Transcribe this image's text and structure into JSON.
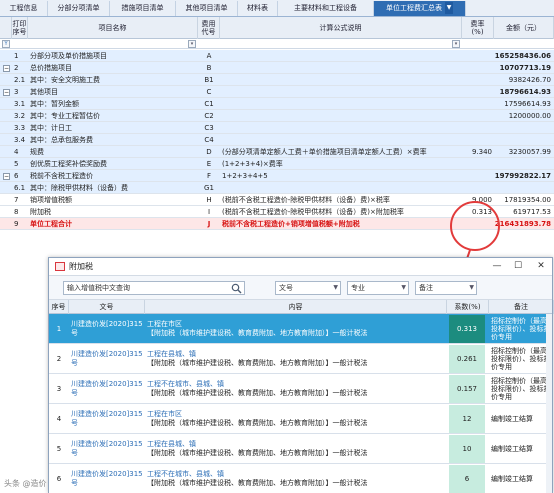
{
  "tabs": [
    "工程信息",
    "分部分项清单",
    "措施项目清单",
    "其他项目清单",
    "材料表",
    "主要材料和工程设备",
    "单位工程费汇总表"
  ],
  "active_tab_index": 6,
  "grid": {
    "headers": {
      "print": "打印\n序号",
      "name": "项目名称",
      "code": "费用\n代号",
      "formula": "计算公式说明",
      "rate": "费率\n(%)",
      "amount": "金额（元）"
    },
    "rows": [
      {
        "num": "1",
        "name": "分部分项及单价措施项目",
        "code": "A",
        "formula": "",
        "rate": "",
        "amount": "165258436.06",
        "style": "blue",
        "bold": true
      },
      {
        "num": "2",
        "name": "总价措施项目",
        "code": "B",
        "formula": "",
        "rate": "",
        "amount": "10707713.19",
        "style": "blue",
        "bold": true,
        "collapse": true
      },
      {
        "num": "2.1",
        "name": "  其中：安全文明施工费",
        "code": "B1",
        "formula": "",
        "rate": "",
        "amount": "9382426.70",
        "style": "blue"
      },
      {
        "num": "3",
        "name": "其他项目",
        "code": "C",
        "formula": "",
        "rate": "",
        "amount": "18796614.93",
        "style": "blue",
        "bold": true,
        "collapse": true
      },
      {
        "num": "3.1",
        "name": "  其中：暂列金额",
        "code": "C1",
        "formula": "",
        "rate": "",
        "amount": "17596614.93",
        "style": "blue"
      },
      {
        "num": "3.2",
        "name": "  其中：专业工程暂估价",
        "code": "C2",
        "formula": "",
        "rate": "",
        "amount": "1200000.00",
        "style": "blue"
      },
      {
        "num": "3.3",
        "name": "  其中：计日工",
        "code": "C3",
        "formula": "",
        "rate": "",
        "amount": "",
        "style": "blue"
      },
      {
        "num": "3.4",
        "name": "  其中：总承包服务费",
        "code": "C4",
        "formula": "",
        "rate": "",
        "amount": "",
        "style": "blue"
      },
      {
        "num": "4",
        "name": "规费",
        "code": "D",
        "formula": "(分部分项清单定额人工费＋单价措施项目清单定额人工费）×费率",
        "rate": "9.340",
        "amount": "3230057.99",
        "style": "blue"
      },
      {
        "num": "5",
        "name": "创优质工程奖补偿奖励费",
        "code": "E",
        "formula": "(1+2+3+4)×费率",
        "rate": "",
        "amount": "",
        "style": "blue"
      },
      {
        "num": "6",
        "name": "税前不含税工程造价",
        "code": "F",
        "formula": "1+2+3+4+5",
        "rate": "",
        "amount": "197992822.17",
        "style": "blue",
        "bold": true,
        "collapse": true
      },
      {
        "num": "6.1",
        "name": "  其中：除税甲供材料（设备）费",
        "code": "G1",
        "formula": "",
        "rate": "",
        "amount": "",
        "style": "blue"
      },
      {
        "num": "7",
        "name": "销项增值税额",
        "code": "H",
        "formula": "(税前不含税工程造价-除税甲供材料（设备）费)×税率",
        "rate": "9.000",
        "amount": "17819354.00",
        "style": "white"
      },
      {
        "num": "8",
        "name": "附加税",
        "code": "I",
        "formula": "(税前不含税工程造价-除税甲供材料（设备）费)×附加税率",
        "rate": "0.313",
        "amount": "619717.53",
        "style": "white"
      },
      {
        "num": "9",
        "name": "单位工程合计",
        "code": "J",
        "formula": "税前不含税工程造价+销项增值税额+附加税",
        "rate": "",
        "amount": "216431893.78",
        "style": "pink",
        "red": true
      }
    ]
  },
  "dialog": {
    "title": "附加税",
    "search_placeholder": "输入增值税中文查询",
    "filter_doc": "文号",
    "filter_major": "专业",
    "filter_note": "备注",
    "headers": {
      "no": "序号",
      "doc": "文号",
      "content": "内容",
      "coef": "系数(%)",
      "note": "备注"
    },
    "rows": [
      {
        "no": "1",
        "doc": "川建造价发[2020]315号",
        "content1": "工程在市区",
        "content2": "【附加税（城市维护建设税、教育费附加、地方教育附加）】一般计税法",
        "coef": "0.313",
        "note": "招标控制价（最高投标限价）、投标报价专用",
        "selected": true
      },
      {
        "no": "2",
        "doc": "川建造价发[2020]315号",
        "content1": "工程在县城、镇",
        "content2": "【附加税（城市维护建设税、教育费附加、地方教育附加）】一般计税法",
        "coef": "0.261",
        "note": "招标控制价（最高投标限价）、投标报价专用"
      },
      {
        "no": "3",
        "doc": "川建造价发[2020]315号",
        "content1": "工程不在城市、县城、镇",
        "content2": "【附加税（城市维护建设税、教育费附加、地方教育附加）】一般计税法",
        "coef": "0.157",
        "note": "招标控制价（最高投标限价）、投标报价专用"
      },
      {
        "no": "4",
        "doc": "川建造价发[2020]315号",
        "content1": "工程在市区",
        "content2": "【附加税（城市维护建设税、教育费附加、地方教育附加）】一般计税法",
        "coef": "12",
        "note": "编制竣工结算"
      },
      {
        "no": "5",
        "doc": "川建造价发[2020]315号",
        "content1": "工程在县城、镇",
        "content2": "【附加税（城市维护建设税、教育费附加、地方教育附加）】一般计税法",
        "coef": "10",
        "note": "编制竣工结算"
      },
      {
        "no": "6",
        "doc": "川建造价发[2020]315号",
        "content1": "工程不在城市、县城、镇",
        "content2": "【附加税（城市维护建设税、教育费附加、地方教育附加）】一般计税法",
        "coef": "6",
        "note": "编制竣工结算"
      }
    ]
  },
  "watermark": "头条 @造价"
}
